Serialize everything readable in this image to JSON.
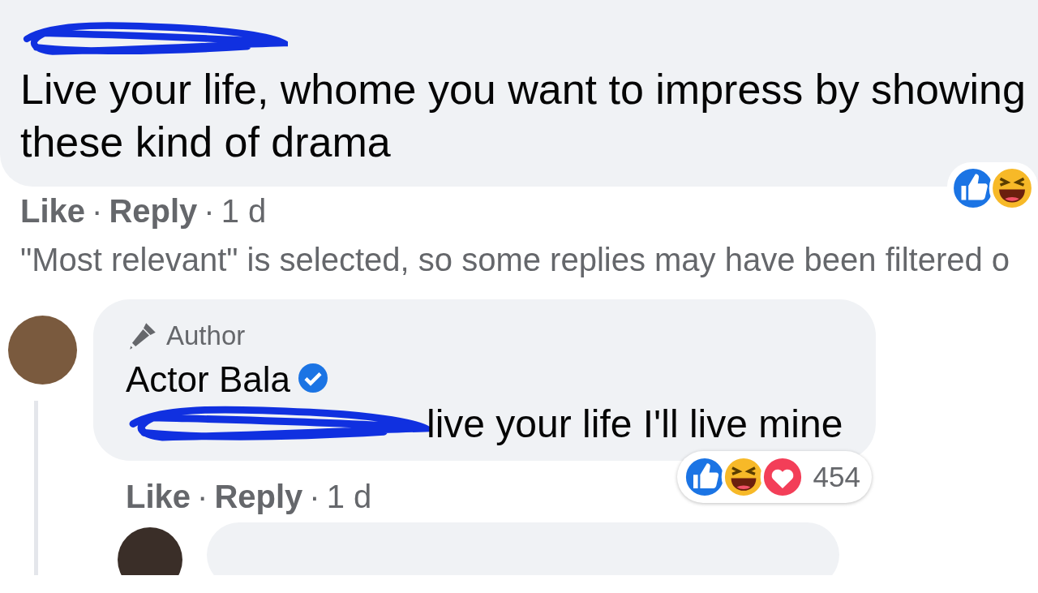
{
  "comment": {
    "text": "Live your life, whome you want to impress by showing these kind of drama",
    "actions": [
      {
        "kind": "link",
        "text": "Like"
      },
      {
        "kind": "separator",
        "text": "·"
      },
      {
        "kind": "link",
        "text": "Reply"
      },
      {
        "kind": "separator",
        "text": "·"
      },
      {
        "kind": "time",
        "text": "1 d"
      }
    ]
  },
  "filter_notice": "\"Most relevant\" is selected, so some replies may have been filtered o",
  "reply": {
    "badge": "Author",
    "author": "Actor Bala",
    "verified": true,
    "text": "live your life I'll live mine",
    "reaction_count": "454",
    "actions": [
      {
        "kind": "link",
        "text": "Like"
      },
      {
        "kind": "separator",
        "text": "·"
      },
      {
        "kind": "link",
        "text": "Reply"
      },
      {
        "kind": "separator",
        "text": "·"
      },
      {
        "kind": "time",
        "text": "1 d"
      }
    ]
  }
}
